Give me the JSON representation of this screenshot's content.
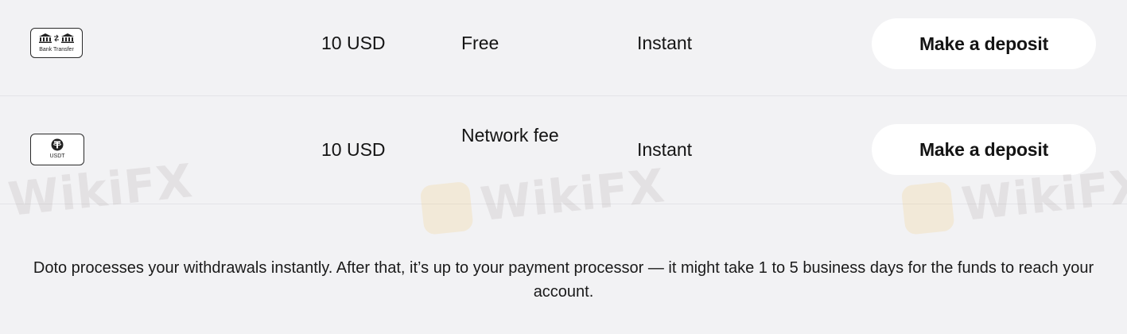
{
  "methods": [
    {
      "badge_label": "Bank Transfer",
      "icon": "bank-transfer-icon",
      "min_amount": "10 USD",
      "fee": "Free",
      "processing_time": "Instant",
      "action_label": "Make a deposit"
    },
    {
      "badge_label": "USDT",
      "icon": "tether-icon",
      "min_amount": "10 USD",
      "fee": "Network fee",
      "processing_time": "Instant",
      "action_label": "Make a deposit"
    }
  ],
  "watermark": {
    "text": "WikiFX"
  },
  "footer": {
    "note": "Doto processes your withdrawals instantly. After that, it’s up to your payment processor — it might take 1 to 5 business days for the funds to reach your account."
  },
  "colors": {
    "background": "#f2f2f4",
    "button_background": "#ffffff",
    "text": "#141414",
    "divider": "#e4e4e7"
  }
}
